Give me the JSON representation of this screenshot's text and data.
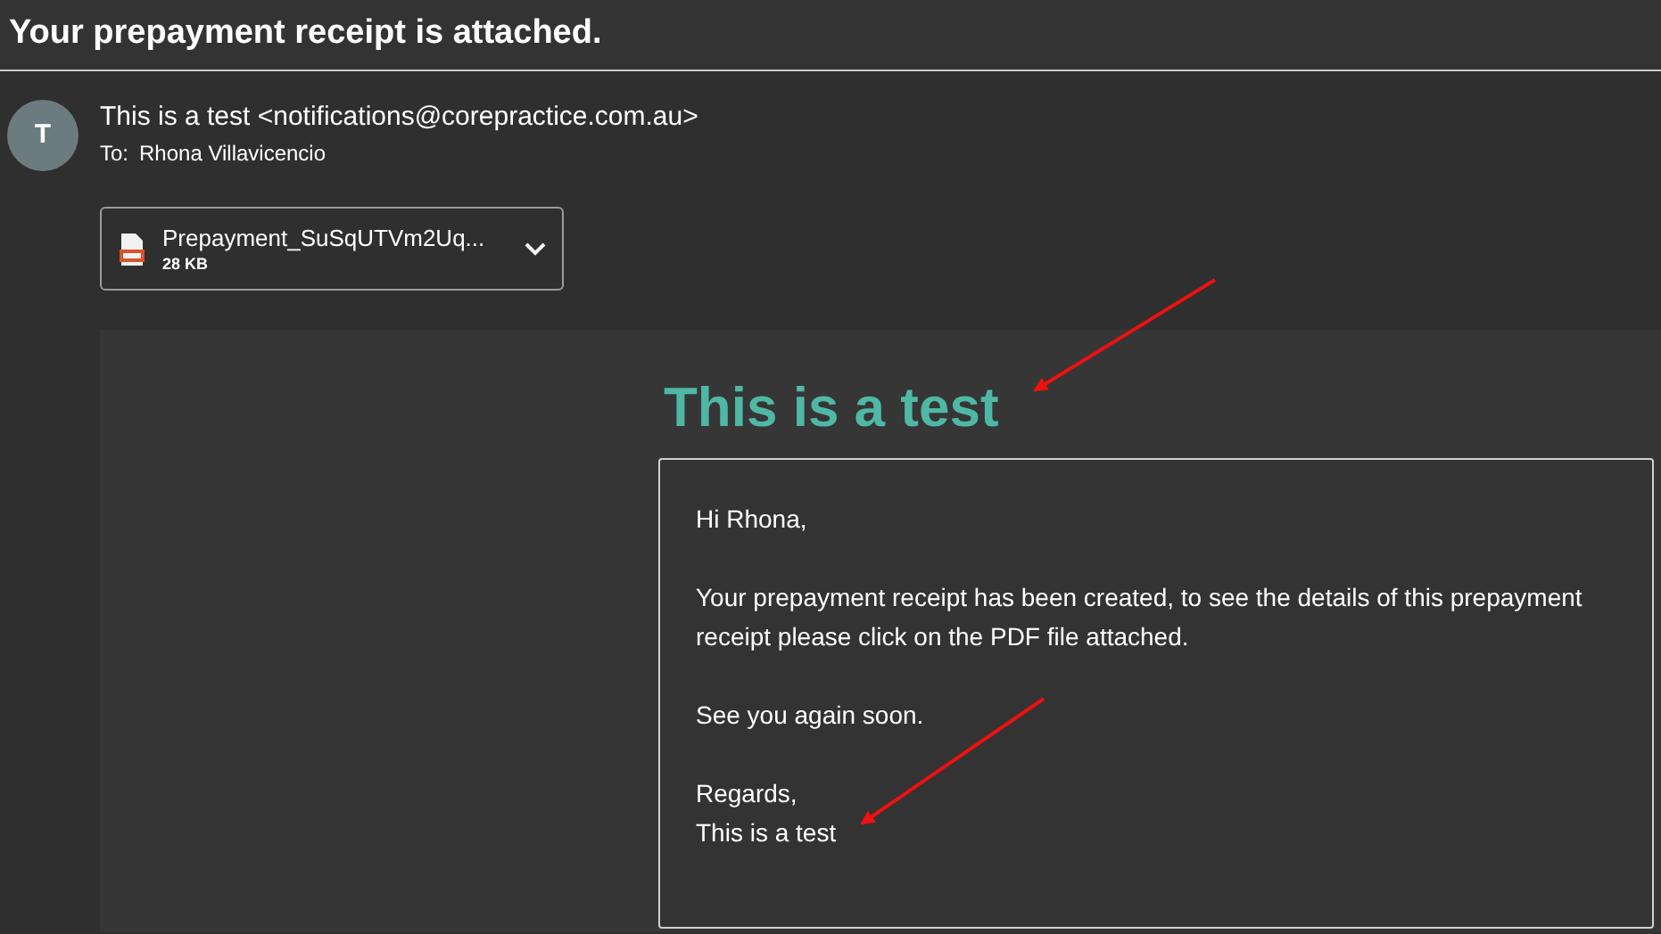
{
  "subject": "Your prepayment receipt is attached.",
  "sender": {
    "avatar": "T",
    "from": "This is a test <notifications@corepractice.com.au>",
    "to_label": "To:",
    "to": "Rhona Villavicencio"
  },
  "attachment": {
    "name": "Prepayment_SuSqUTVm2Uq...",
    "size": "28 KB"
  },
  "body": {
    "heading": "This is a test",
    "paragraphs": [
      "Hi Rhona,",
      "Your prepayment receipt has been created, to see the details of this prepayment receipt please click on the PDF file attached.",
      "See you again soon.",
      "Regards,\nThis is a test"
    ]
  }
}
